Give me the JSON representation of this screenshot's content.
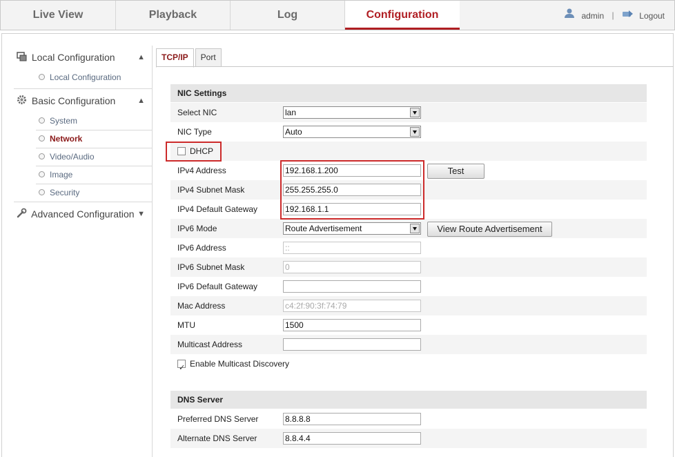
{
  "topnav": {
    "tabs": [
      "Live View",
      "Playback",
      "Log",
      "Configuration"
    ],
    "active": "Configuration",
    "user": "admin",
    "logout": "Logout"
  },
  "sidebar": {
    "local_group": "Local Configuration",
    "local_items": [
      "Local Configuration"
    ],
    "basic_group": "Basic Configuration",
    "basic_items": [
      "System",
      "Network",
      "Video/Audio",
      "Image",
      "Security"
    ],
    "active_item": "Network",
    "advanced_group": "Advanced Configuration"
  },
  "tabs": [
    "TCP/IP",
    "Port"
  ],
  "nic": {
    "header": "NIC Settings",
    "select_nic_label": "Select NIC",
    "select_nic_value": "lan",
    "nic_type_label": "NIC Type",
    "nic_type_value": "Auto",
    "dhcp_label": "DHCP",
    "dhcp_checked": false,
    "ipv4_address_label": "IPv4 Address",
    "ipv4_address": "192.168.1.200",
    "test_button": "Test",
    "ipv4_mask_label": "IPv4 Subnet Mask",
    "ipv4_mask": "255.255.255.0",
    "ipv4_gateway_label": "IPv4 Default Gateway",
    "ipv4_gateway": "192.168.1.1",
    "ipv6_mode_label": "IPv6 Mode",
    "ipv6_mode_value": "Route Advertisement",
    "view_route_button": "View Route Advertisement",
    "ipv6_address_label": "IPv6 Address",
    "ipv6_address": "::",
    "ipv6_mask_label": "IPv6 Subnet Mask",
    "ipv6_mask": "0",
    "ipv6_gateway_label": "IPv6 Default Gateway",
    "ipv6_gateway": "",
    "mac_label": "Mac Address",
    "mac": "c4:2f:90:3f:74:79",
    "mtu_label": "MTU",
    "mtu": "1500",
    "multicast_label": "Multicast Address",
    "multicast": "",
    "multicast_discovery_label": "Enable Multicast Discovery",
    "multicast_discovery_checked": true
  },
  "dns": {
    "header": "DNS Server",
    "preferred_label": "Preferred DNS Server",
    "preferred": "8.8.8.8",
    "alternate_label": "Alternate DNS Server",
    "alternate": "8.8.4.4"
  },
  "colors": {
    "accent": "#b01e23",
    "highlight_box": "#cc2a2a"
  }
}
